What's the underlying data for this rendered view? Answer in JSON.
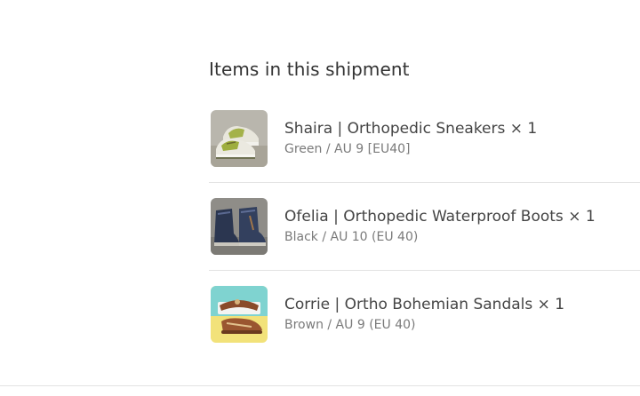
{
  "shipment": {
    "title": "Items in this shipment",
    "items": [
      {
        "name": "Shaira | Orthopedic Sneakers × 1",
        "variant": "Green / AU 9 [EU40]",
        "image_icon": "green-sneakers-image"
      },
      {
        "name": "Ofelia | Orthopedic Waterproof Boots × 1",
        "variant": "Black / AU 10 (EU 40)",
        "image_icon": "dark-boots-image"
      },
      {
        "name": "Corrie | Ortho Bohemian Sandals × 1",
        "variant": "Brown / AU 9 (EU 40)",
        "image_icon": "brown-sandals-image"
      }
    ]
  }
}
